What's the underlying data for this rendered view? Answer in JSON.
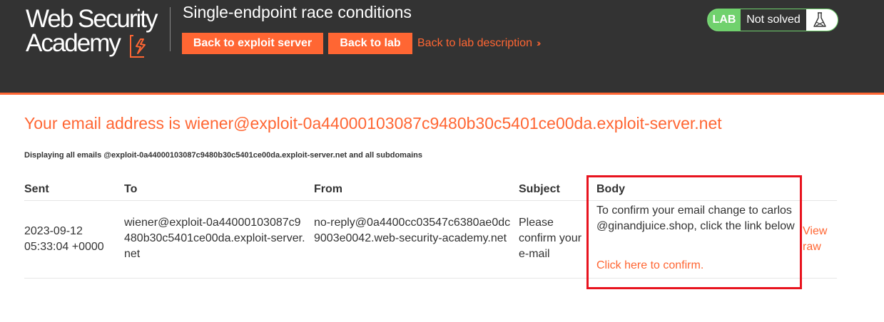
{
  "header": {
    "logo_line1": "Web Security",
    "logo_line2": "Academy",
    "lab_title": "Single-endpoint race conditions",
    "back_to_exploit_server": "Back to exploit server",
    "back_to_lab": "Back to lab",
    "back_to_lab_description": "Back to lab description",
    "status_badge": "LAB",
    "status_text": "Not solved",
    "colors": {
      "brand": "#ff6633",
      "header_bg": "#333333",
      "lab_green": "#70d16d"
    }
  },
  "main": {
    "email_heading": "Your email address is wiener@exploit-0a44000103087c9480b30c5401ce00da.exploit-server.net",
    "display_note": "Displaying all emails @exploit-0a44000103087c9480b30c5401ce00da.exploit-server.net and all subdomains",
    "table": {
      "headers": {
        "sent": "Sent",
        "to": "To",
        "from": "From",
        "subject": "Subject",
        "body": "Body"
      },
      "rows": [
        {
          "sent": "2023-09-12 05:33:04 +0000",
          "to": "wiener@exploit-0a44000103087c9480b30c5401ce00da.exploit-server.net",
          "from": "no-reply@0a4400cc03547c6380ae0dc9003e0042.web-security-academy.net",
          "subject": "Please confirm your e-mail",
          "body": "To confirm your email change to carlos@ginandjuice.shop, click the link below",
          "confirm_link": "Click here to confirm.",
          "view_raw": "View raw"
        }
      ]
    }
  }
}
